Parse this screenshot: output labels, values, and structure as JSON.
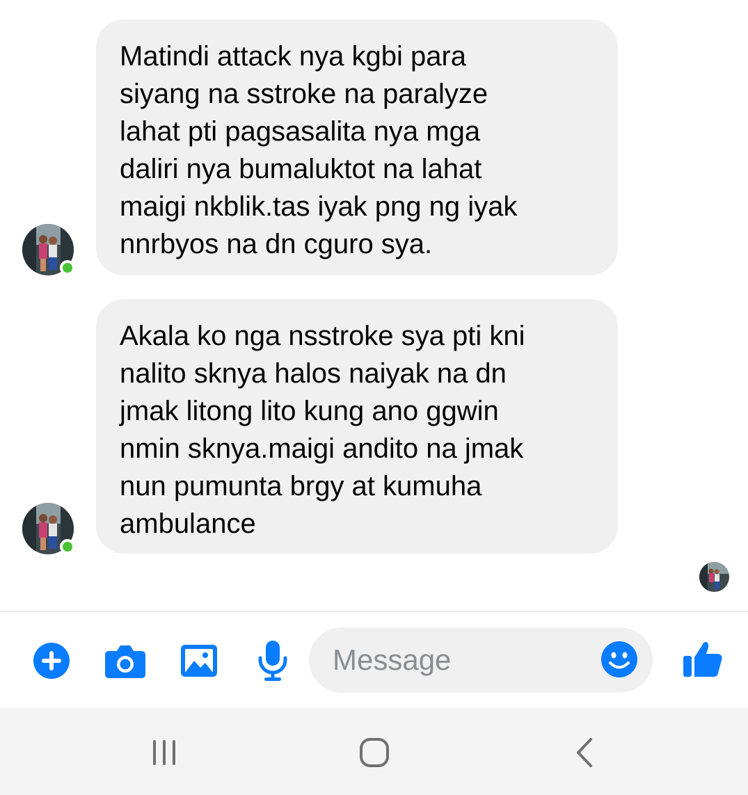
{
  "messages": [
    {
      "sender": "contact",
      "text": "Matindi attack nya kgbi para\nsiyang na sstroke na paralyze\nlahat pti pagsasalita nya mga\ndaliri nya bumaluktot na lahat\nmaigi nkblik.tas iyak png ng iyak\nnnrbyos na dn cguro sya."
    },
    {
      "sender": "contact",
      "text": "Akala ko nga nsstroke sya pti kni\nnalito sknya halos naiyak na dn\njmak litong lito kung ano ggwin\nnmin sknya.maigi andito na jmak\nnun pumunta brgy at kumuha\nambulance"
    }
  ],
  "composer": {
    "placeholder": "Message",
    "icons": [
      "plus-icon",
      "camera-icon",
      "gallery-icon",
      "microphone-icon",
      "emoji-icon",
      "thumbs-up-icon"
    ]
  },
  "navbar": {
    "icons": [
      "recents-icon",
      "home-icon",
      "back-icon"
    ]
  },
  "colors": {
    "accent": "#0a7cff",
    "bubble": "#f0f0f0",
    "online": "#46c234",
    "placeholder": "#8a8d91",
    "navbar_bg": "#f4f4f4",
    "nav_icon": "#707070"
  }
}
